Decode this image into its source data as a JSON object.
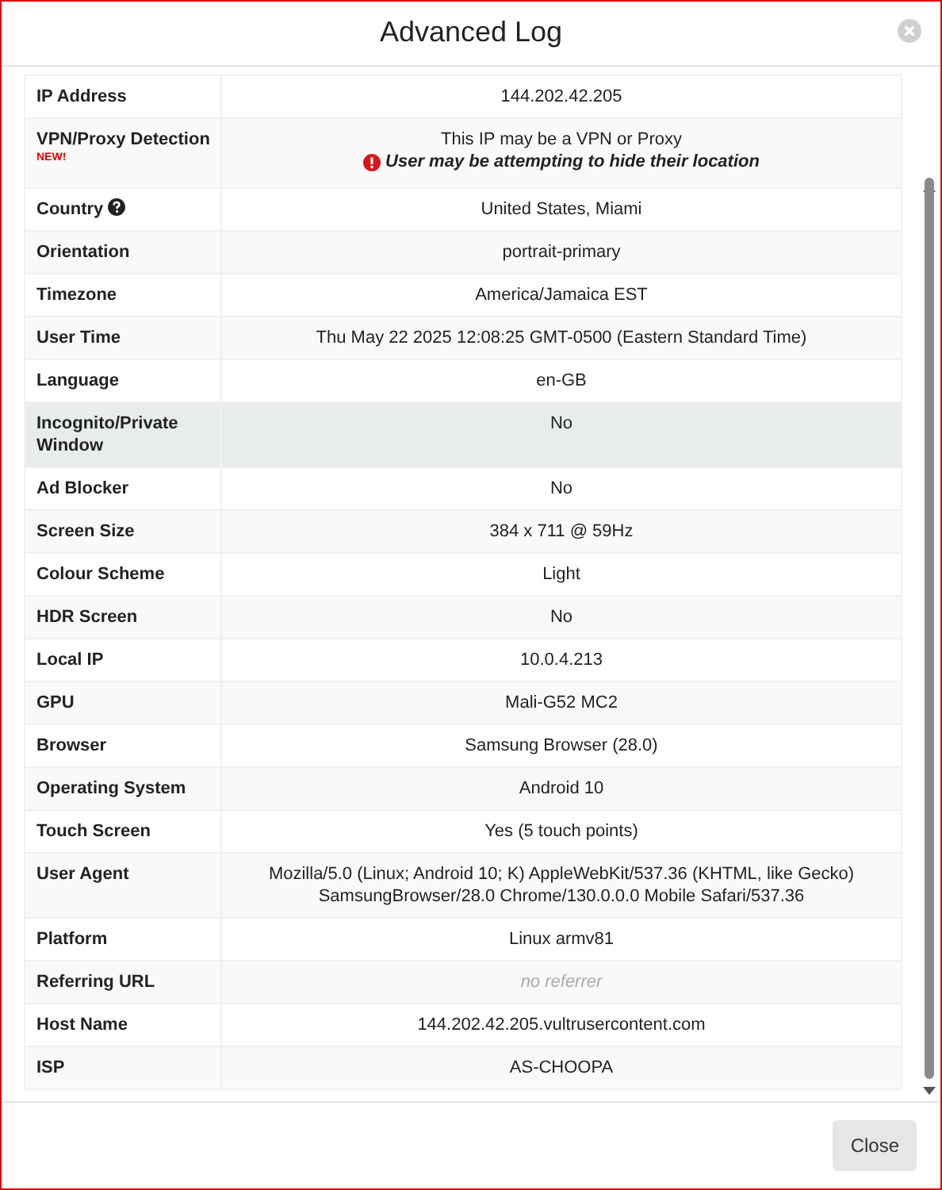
{
  "modal": {
    "title": "Advanced Log"
  },
  "rows": [
    {
      "label": "IP Address",
      "value": "144.202.42.205",
      "highlighted": false
    },
    {
      "label": "VPN/Proxy Detection",
      "badge": "NEW!",
      "value": "This IP may be a VPN or Proxy",
      "warning": "User may be attempting to hide their location",
      "highlighted": false
    },
    {
      "label": "Country",
      "help_icon": true,
      "value": "United States, Miami",
      "highlighted": false
    },
    {
      "label": "Orientation",
      "value": "portrait-primary",
      "highlighted": false
    },
    {
      "label": "Timezone",
      "value": "America/Jamaica EST",
      "highlighted": false
    },
    {
      "label": "User Time",
      "value": "Thu May 22 2025 12:08:25 GMT-0500 (Eastern Standard Time)",
      "highlighted": false
    },
    {
      "label": "Language",
      "value": "en-GB",
      "highlighted": false
    },
    {
      "label": "Incognito/Private Window",
      "value": "No",
      "highlighted": true
    },
    {
      "label": "Ad Blocker",
      "value": "No",
      "highlighted": false
    },
    {
      "label": "Screen Size",
      "value": "384 x 711 @ 59Hz",
      "highlighted": false
    },
    {
      "label": "Colour Scheme",
      "value": "Light",
      "highlighted": false
    },
    {
      "label": "HDR Screen",
      "value": "No",
      "highlighted": false
    },
    {
      "label": "Local IP",
      "value": "10.0.4.213",
      "highlighted": false
    },
    {
      "label": "GPU",
      "value": "Mali-G52 MC2",
      "highlighted": false
    },
    {
      "label": "Browser",
      "value": "Samsung Browser (28.0)",
      "highlighted": false
    },
    {
      "label": "Operating System",
      "value": "Android 10",
      "highlighted": false
    },
    {
      "label": "Touch Screen",
      "value": "Yes (5 touch points)",
      "highlighted": false
    },
    {
      "label": "User Agent",
      "value": "Mozilla/5.0 (Linux; Android 10; K) AppleWebKit/537.36 (KHTML, like Gecko) SamsungBrowser/28.0 Chrome/130.0.0.0 Mobile Safari/537.36",
      "highlighted": false
    },
    {
      "label": "Platform",
      "value": "Linux armv81",
      "highlighted": false
    },
    {
      "label": "Referring URL",
      "value": "no referrer",
      "muted": true,
      "highlighted": false
    },
    {
      "label": "Host Name",
      "value": "144.202.42.205.vultrusercontent.com",
      "highlighted": false
    },
    {
      "label": "ISP",
      "value": "AS-CHOOPA",
      "highlighted": false
    }
  ],
  "footer": {
    "button": "Close"
  }
}
